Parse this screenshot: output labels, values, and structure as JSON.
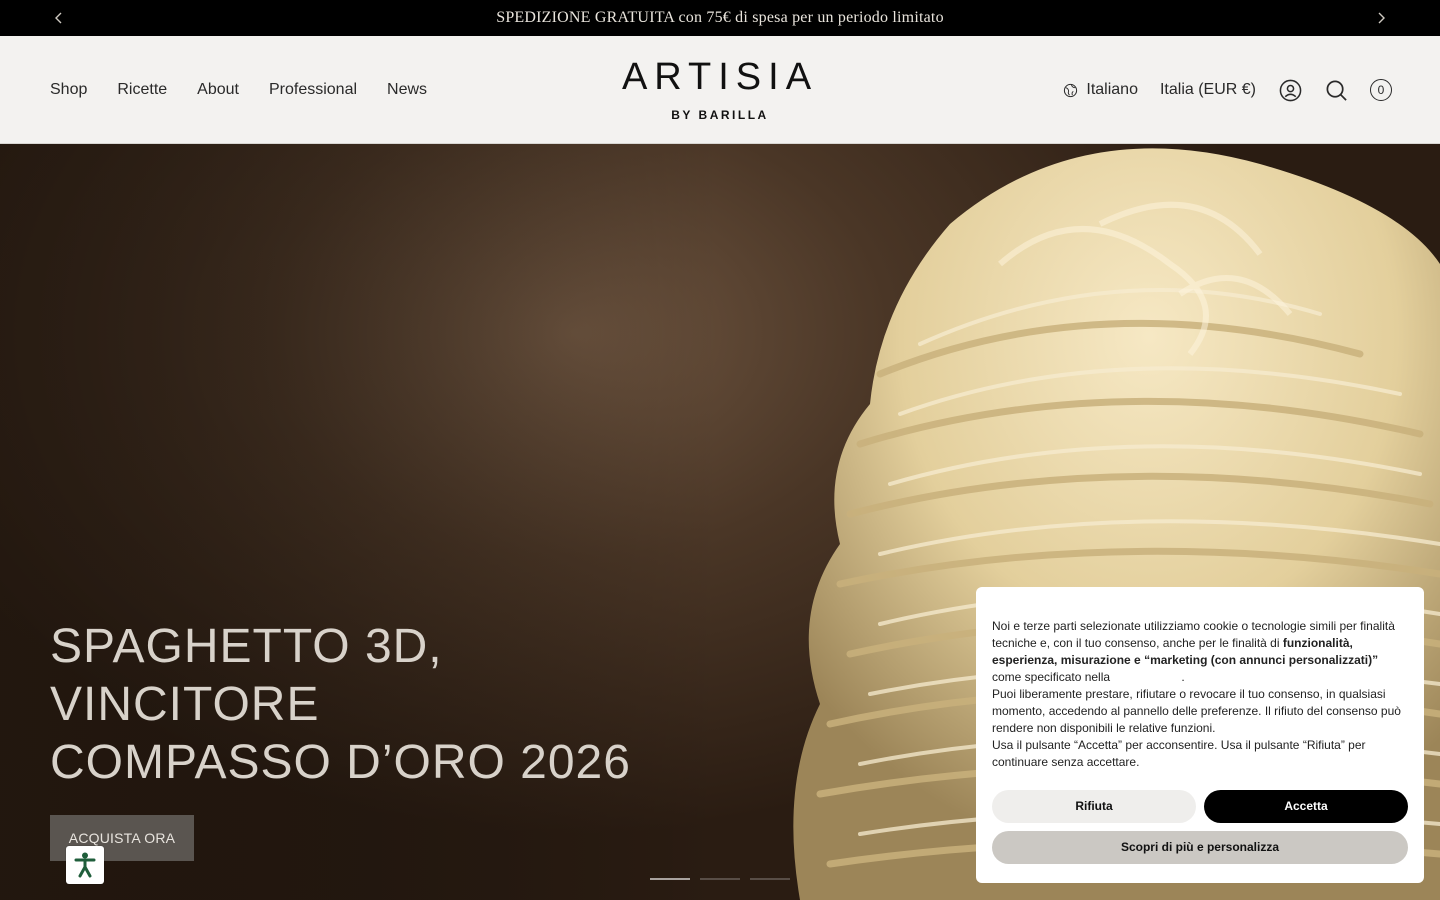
{
  "announcement": {
    "text": "SPEDIZIONE GRATUITA con 75€ di spesa per un periodo limitato"
  },
  "nav": {
    "items": [
      "Shop",
      "Ricette",
      "About",
      "Professional",
      "News"
    ]
  },
  "logo": {
    "main": "ARTISIA",
    "sub": "BY BARILLA"
  },
  "header": {
    "language": "Italiano",
    "country": "Italia (EUR €)",
    "cart_count": "0"
  },
  "hero": {
    "title_lines": [
      "SPAGHETTO 3D,",
      "VINCITORE",
      "COMPASSO D’ORO 2026"
    ],
    "cta": "ACQUISTA ORA",
    "slides": 3,
    "active_slide": 1
  },
  "cookie": {
    "p1_a": "Noi e terze parti selezionate utilizziamo cookie o tecnologie simili per finalità tecniche e, con il tuo consenso, anche per le finalità di ",
    "p1_bold": "funzionalità, esperienza, misurazione e “marketing (con annunci personalizzati)”",
    "p1_b": " come specificato nella",
    "p1_end": ".",
    "p2": "Puoi liberamente prestare, rifiutare o revocare il tuo consenso, in qualsiasi momento, accedendo al pannello delle preferenze. Il rifiuto del consenso può rendere non disponibili le relative funzioni.",
    "p3": "Usa il pulsante “Accetta” per acconsentire. Usa il pulsante “Rifiuta” per continuare senza accettare.",
    "reject": "Rifiuta",
    "accept": "Accetta",
    "more": "Scopri di più e personalizza"
  },
  "colors": {
    "announce_bg": "#000000",
    "header_bg": "#f3f2f0",
    "hero_brown": "#4a3626",
    "accept_bg": "#000000",
    "a11y_green": "#1f5e3b"
  }
}
